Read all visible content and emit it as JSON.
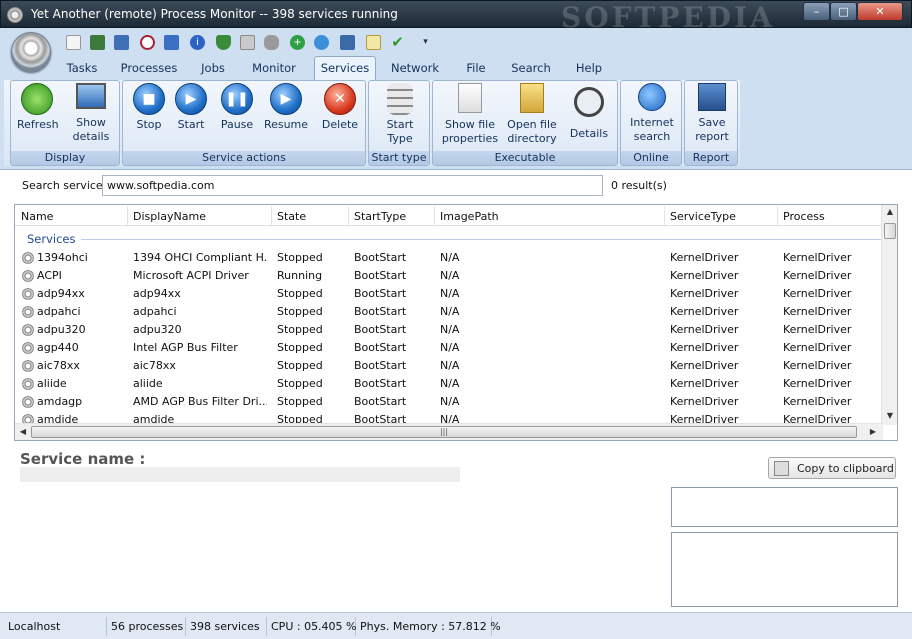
{
  "window": {
    "title": "Yet Another (remote) Process Monitor -- 398 services running",
    "watermark": "SOFTPEDIA",
    "minimize_glyph": "–",
    "maximize_glyph": "□",
    "close_glyph": "✕"
  },
  "quick_access_icons": [
    "new-icon",
    "monitor-icon",
    "screen-icon",
    "target-icon",
    "network-icon",
    "info-icon",
    "shield-icon",
    "tools-icon",
    "database-icon",
    "add-icon",
    "globe-icon",
    "save-icon",
    "copy-icon",
    "check-icon",
    "dropdown-icon"
  ],
  "tabs": [
    {
      "label": "Tasks"
    },
    {
      "label": "Processes"
    },
    {
      "label": "Jobs"
    },
    {
      "label": "Monitor"
    },
    {
      "label": "Services",
      "active": true
    },
    {
      "label": "Network"
    },
    {
      "label": "File"
    },
    {
      "label": "Search"
    },
    {
      "label": "Help"
    }
  ],
  "ribbon": {
    "display": {
      "label": "Display",
      "refresh": "Refresh",
      "show_details_1": "Show",
      "show_details_2": "details"
    },
    "service_actions": {
      "label": "Service actions",
      "stop": "Stop",
      "start": "Start",
      "pause": "Pause",
      "resume": "Resume",
      "delete": "Delete"
    },
    "start_type": {
      "label": "Start type",
      "start_1": "Start",
      "start_2": "Type"
    },
    "executable": {
      "label": "Executable",
      "show_file_1": "Show file",
      "show_file_2": "properties",
      "open_dir_1": "Open file",
      "open_dir_2": "directory",
      "details": "Details"
    },
    "online": {
      "label": "Online",
      "internet_1": "Internet",
      "internet_2": "search"
    },
    "report": {
      "label": "Report",
      "save_1": "Save",
      "save_2": "report"
    }
  },
  "search": {
    "label": "Search service",
    "value": "www.softpedia.com",
    "result": "0 result(s)"
  },
  "list": {
    "columns": [
      "Name",
      "DisplayName",
      "State",
      "StartType",
      "ImagePath",
      "ServiceType",
      "Process"
    ],
    "group": "Services",
    "rows": [
      [
        "1394ohci",
        "1394 OHCI Compliant H...",
        "Stopped",
        "BootStart",
        "N/A",
        "KernelDriver",
        "KernelDriver"
      ],
      [
        "ACPI",
        "Microsoft ACPI Driver",
        "Running",
        "BootStart",
        "N/A",
        "KernelDriver",
        "KernelDriver"
      ],
      [
        "adp94xx",
        "adp94xx",
        "Stopped",
        "BootStart",
        "N/A",
        "KernelDriver",
        "KernelDriver"
      ],
      [
        "adpahci",
        "adpahci",
        "Stopped",
        "BootStart",
        "N/A",
        "KernelDriver",
        "KernelDriver"
      ],
      [
        "adpu320",
        "adpu320",
        "Stopped",
        "BootStart",
        "N/A",
        "KernelDriver",
        "KernelDriver"
      ],
      [
        "agp440",
        "Intel AGP Bus Filter",
        "Stopped",
        "BootStart",
        "N/A",
        "KernelDriver",
        "KernelDriver"
      ],
      [
        "aic78xx",
        "aic78xx",
        "Stopped",
        "BootStart",
        "N/A",
        "KernelDriver",
        "KernelDriver"
      ],
      [
        "aliide",
        "aliide",
        "Stopped",
        "BootStart",
        "N/A",
        "KernelDriver",
        "KernelDriver"
      ],
      [
        "amdagp",
        "AMD AGP Bus Filter Dri...",
        "Stopped",
        "BootStart",
        "N/A",
        "KernelDriver",
        "KernelDriver"
      ],
      [
        "amdide",
        "amdide",
        "Stopped",
        "BootStart",
        "N/A",
        "KernelDriver",
        "KernelDriver"
      ]
    ]
  },
  "details": {
    "service_name_label": "Service name :",
    "copy_button": "Copy to clipboard"
  },
  "statusbar": {
    "host": "Localhost",
    "processes": "56 processes",
    "services": "398 services",
    "cpu": "CPU : 05.405 %",
    "memory": "Phys. Memory : 57.812 %"
  },
  "colors": {
    "ribbon": "#cfdff2",
    "title": "#2b3a48",
    "group_header": "#1e4a8f"
  }
}
